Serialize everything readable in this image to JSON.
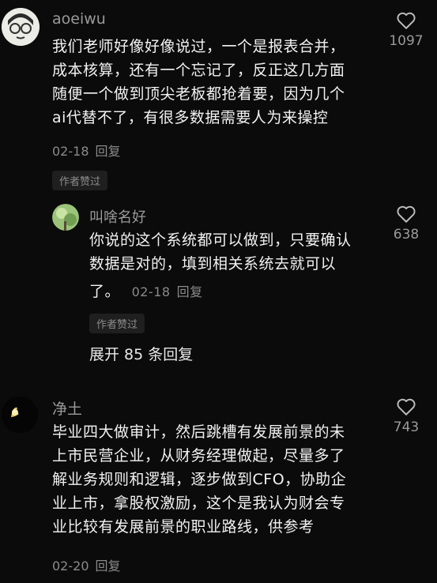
{
  "comments": [
    {
      "username": "aoeiwu",
      "lines": [
        "我们老师好像好像说过，一个是报表合并，",
        "成本核算，还有一个忘记了，反正这几方面",
        "随便一个做到顶尖老板都抢着要，因为几个",
        "ai代替不了，有很多数据需要人为来操控"
      ],
      "date": "02-18",
      "reply": "回复",
      "likes": "1097",
      "badge": "作者赞过"
    },
    {
      "username": "叫啥名好",
      "lines": [
        "你说的这个系统都可以做到，只要确认",
        "数据是对的，填到相关系统去就可以了。"
      ],
      "line3_text": "了。",
      "date": "02-18",
      "reply": "回复",
      "likes": "638",
      "badge": "作者赞过"
    },
    {
      "username": "净土",
      "lines": [
        "毕业四大做审计，然后跳槽有发展前景的未",
        "上市民营企业，从财务经理做起，尽量多了",
        "解业务规则和逻辑，逐步做到CFO，协助企",
        "业上市，拿股权激励，这个是我认为财会专",
        "业比较有发展前景的职业路线，供参考"
      ],
      "date": "02-20",
      "reply": "回复",
      "likes": "743"
    }
  ],
  "expand_replies": "展开 85 条回复",
  "icons": {
    "like": "heart-outline-icon"
  },
  "colors": {
    "background": "#0b0b0b",
    "text": "#f2f2f2",
    "muted": "#8a8a8a"
  }
}
